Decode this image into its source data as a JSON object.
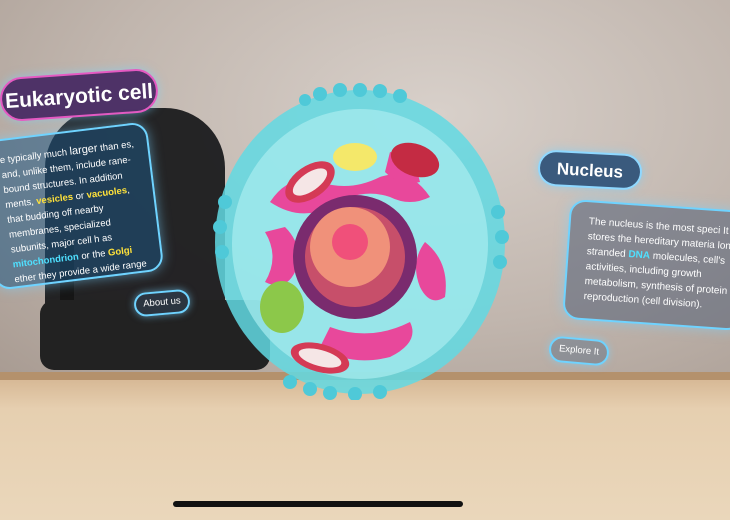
{
  "left_panel": {
    "title": "Eukaryotic cell",
    "text_parts": [
      {
        "t": "e typically much ",
        "c": ""
      },
      {
        "t": "larger",
        "c": "big"
      },
      {
        "t": " than es, and, unlike them, include rane-bound structures. In addition ments, ",
        "c": ""
      },
      {
        "t": "vesicles",
        "c": "hl-yellow"
      },
      {
        "t": " or ",
        "c": ""
      },
      {
        "t": "vacuoles",
        "c": "hl-yellow"
      },
      {
        "t": ", that budding off nearby membranes, specialized subunits, major cell h as ",
        "c": ""
      },
      {
        "t": "mitochondrion",
        "c": "hl-cyan"
      },
      {
        "t": " or the ",
        "c": ""
      },
      {
        "t": "Golgi",
        "c": "hl-yellow"
      },
      {
        "t": " ether they provide a wide range of sufficient for all types of cells.",
        "c": ""
      }
    ],
    "button": "About us"
  },
  "right_panel": {
    "title": "Nucleus",
    "text_parts": [
      {
        "t": "The nucleus is the most speci It stores the hereditary materia long stranded ",
        "c": ""
      },
      {
        "t": "DNA",
        "c": "hl-cyan"
      },
      {
        "t": " molecules, cell's activities, including growth metabolism, synthesis of protein reproduction (cell division).",
        "c": ""
      }
    ],
    "button": "Explore It"
  },
  "colors": {
    "membrane": "#5fd8e0",
    "cytoplasm": "#8fe6ea",
    "er": "#e8489b",
    "nucleus": "#7a2b6e",
    "nucleolus": "#f36a86",
    "mitochondria": "#d43a55",
    "chloro": "#8cc84a"
  }
}
